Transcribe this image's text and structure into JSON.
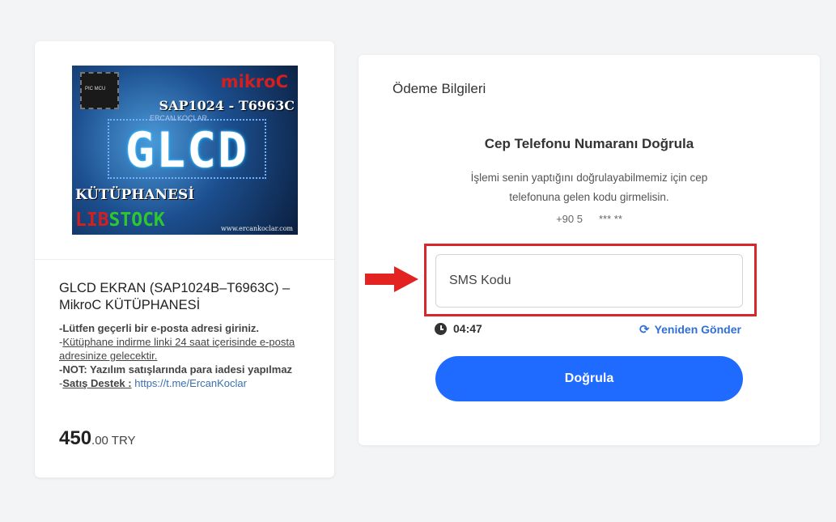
{
  "product": {
    "image_texts": {
      "chip_label": "PIC MCU",
      "brand": "mikroC",
      "model": "SAP1024 - T6963C",
      "author": "ERCAN KOÇLAR",
      "main": "GLCD",
      "subtitle": "KÜTÜPHANESİ",
      "lib_prefix": "LIB",
      "lib_suffix": "STOCK",
      "url": "www.ercankoclar.com"
    },
    "title": "GLCD EKRAN (SAP1024B–T6963C) – MikroC KÜTÜPHANESİ",
    "note1": "-Lütfen geçerli bir e-posta adresi giriniz.",
    "note2_prefix": "-",
    "note2_link": "Kütüphane indirme linki 24 saat içerisinde e-posta adresinize gelecektir.",
    "note3": "-NOT: Yazılım satışlarında para iadesi yapılmaz",
    "note4_prefix": "-",
    "note4_label": "Satış Destek :",
    "note4_link": "https://t.me/ErcanKoclar",
    "price_int": "450",
    "price_dec": ".00 TRY"
  },
  "payment": {
    "title": "Ödeme Bilgileri",
    "heading": "Cep Telefonu Numaranı Doğrula",
    "description": "İşlemi senin yaptığını doğrulayabilmemiz için cep telefonuna gelen kodu girmelisin.",
    "phone_prefix": "+90 5",
    "phone_masked": "*** **",
    "sms_placeholder": "SMS Kodu",
    "timer": "04:47",
    "resend_label": "Yeniden Gönder",
    "verify_label": "Doğrula"
  },
  "colors": {
    "accent": "#1f6bff",
    "highlight": "#d9252b",
    "link": "#2f6fd6"
  }
}
